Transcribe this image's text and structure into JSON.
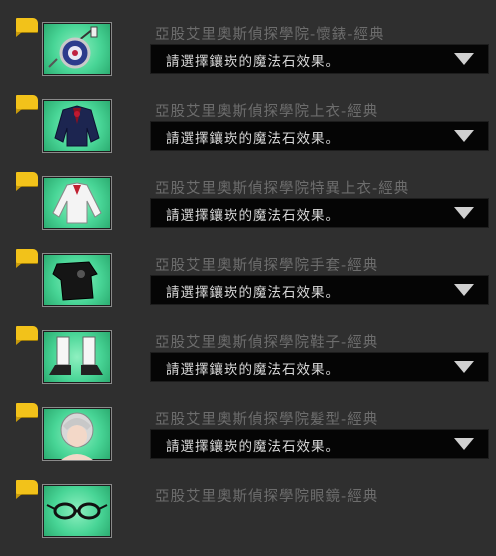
{
  "items": [
    {
      "name": "亞股艾里奧斯偵探學院-懷錶-經典",
      "icon": "pocket-watch-icon",
      "select_value": "請選擇鑲崁的魔法石效果。",
      "has_select": true
    },
    {
      "name": "亞股艾里奧斯偵探學院上衣-經典",
      "icon": "academy-jacket-icon",
      "select_value": "請選擇鑲崁的魔法石效果。",
      "has_select": true
    },
    {
      "name": "亞股艾里奧斯偵探學院特異上衣-經典",
      "icon": "white-shirt-icon",
      "select_value": "請選擇鑲崁的魔法石效果。",
      "has_select": true
    },
    {
      "name": "亞股艾里奧斯偵探學院手套-經典",
      "icon": "black-glove-icon",
      "select_value": "請選擇鑲崁的魔法石效果。",
      "has_select": true
    },
    {
      "name": "亞股艾里奧斯偵探學院鞋子-經典",
      "icon": "shoes-icon",
      "select_value": "請選擇鑲崁的魔法石效果。",
      "has_select": true
    },
    {
      "name": "亞股艾里奧斯偵探學院髮型-經典",
      "icon": "silver-hair-icon",
      "select_value": "請選擇鑲崁的魔法石效果。",
      "has_select": true
    },
    {
      "name": "亞股艾里奧斯偵探學院眼鏡-經典",
      "icon": "glasses-icon",
      "has_select": false
    }
  ],
  "colors": {
    "tag": "#f2c21a",
    "thumb_bg": "#48d596",
    "name_text": "#6d6d6d",
    "select_bg": "#050505"
  }
}
